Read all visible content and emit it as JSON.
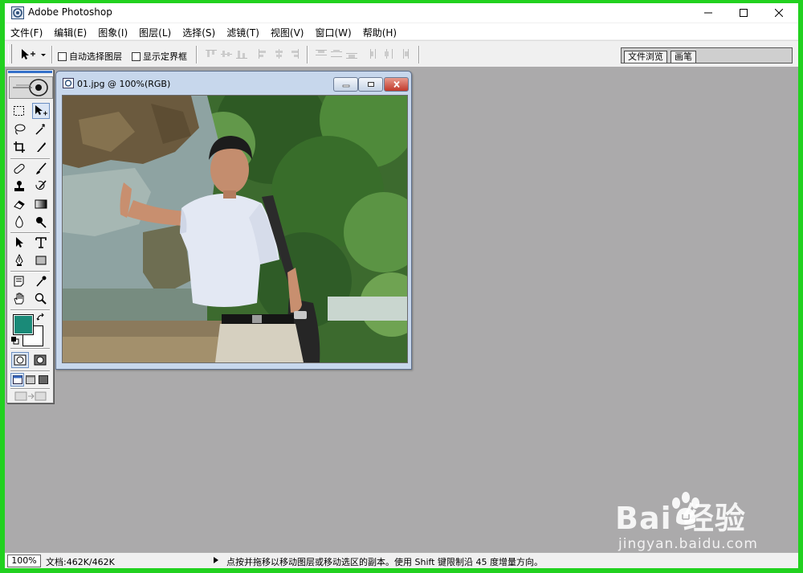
{
  "window": {
    "title": "Adobe Photoshop",
    "controls": [
      "minimize",
      "maximize",
      "close"
    ]
  },
  "menu": [
    {
      "label": "文件(F)"
    },
    {
      "label": "编辑(E)"
    },
    {
      "label": "图象(I)"
    },
    {
      "label": "图层(L)"
    },
    {
      "label": "选择(S)"
    },
    {
      "label": "滤镜(T)"
    },
    {
      "label": "视图(V)"
    },
    {
      "label": "窗口(W)"
    },
    {
      "label": "帮助(H)"
    }
  ],
  "options_bar": {
    "auto_select_label": "自动选择图层",
    "show_bounds_label": "显示定界框",
    "palette_well_tabs": [
      "文件浏览",
      "画笔"
    ]
  },
  "toolbox": {
    "foreground_color": "#1a8a78",
    "background_color": "#ffffff",
    "active_tool": "move-tool"
  },
  "document": {
    "title": "01.jpg @ 100%(RGB)"
  },
  "status": {
    "zoom": "100%",
    "doc_size": "文档:462K/462K",
    "hint": "点按并拖移以移动图层或移动选区的副本。使用 Shift 键限制沿 45 度增量方向。"
  },
  "watermark": {
    "brand": "Bai  经验",
    "url": "jingyan.baidu.com"
  }
}
